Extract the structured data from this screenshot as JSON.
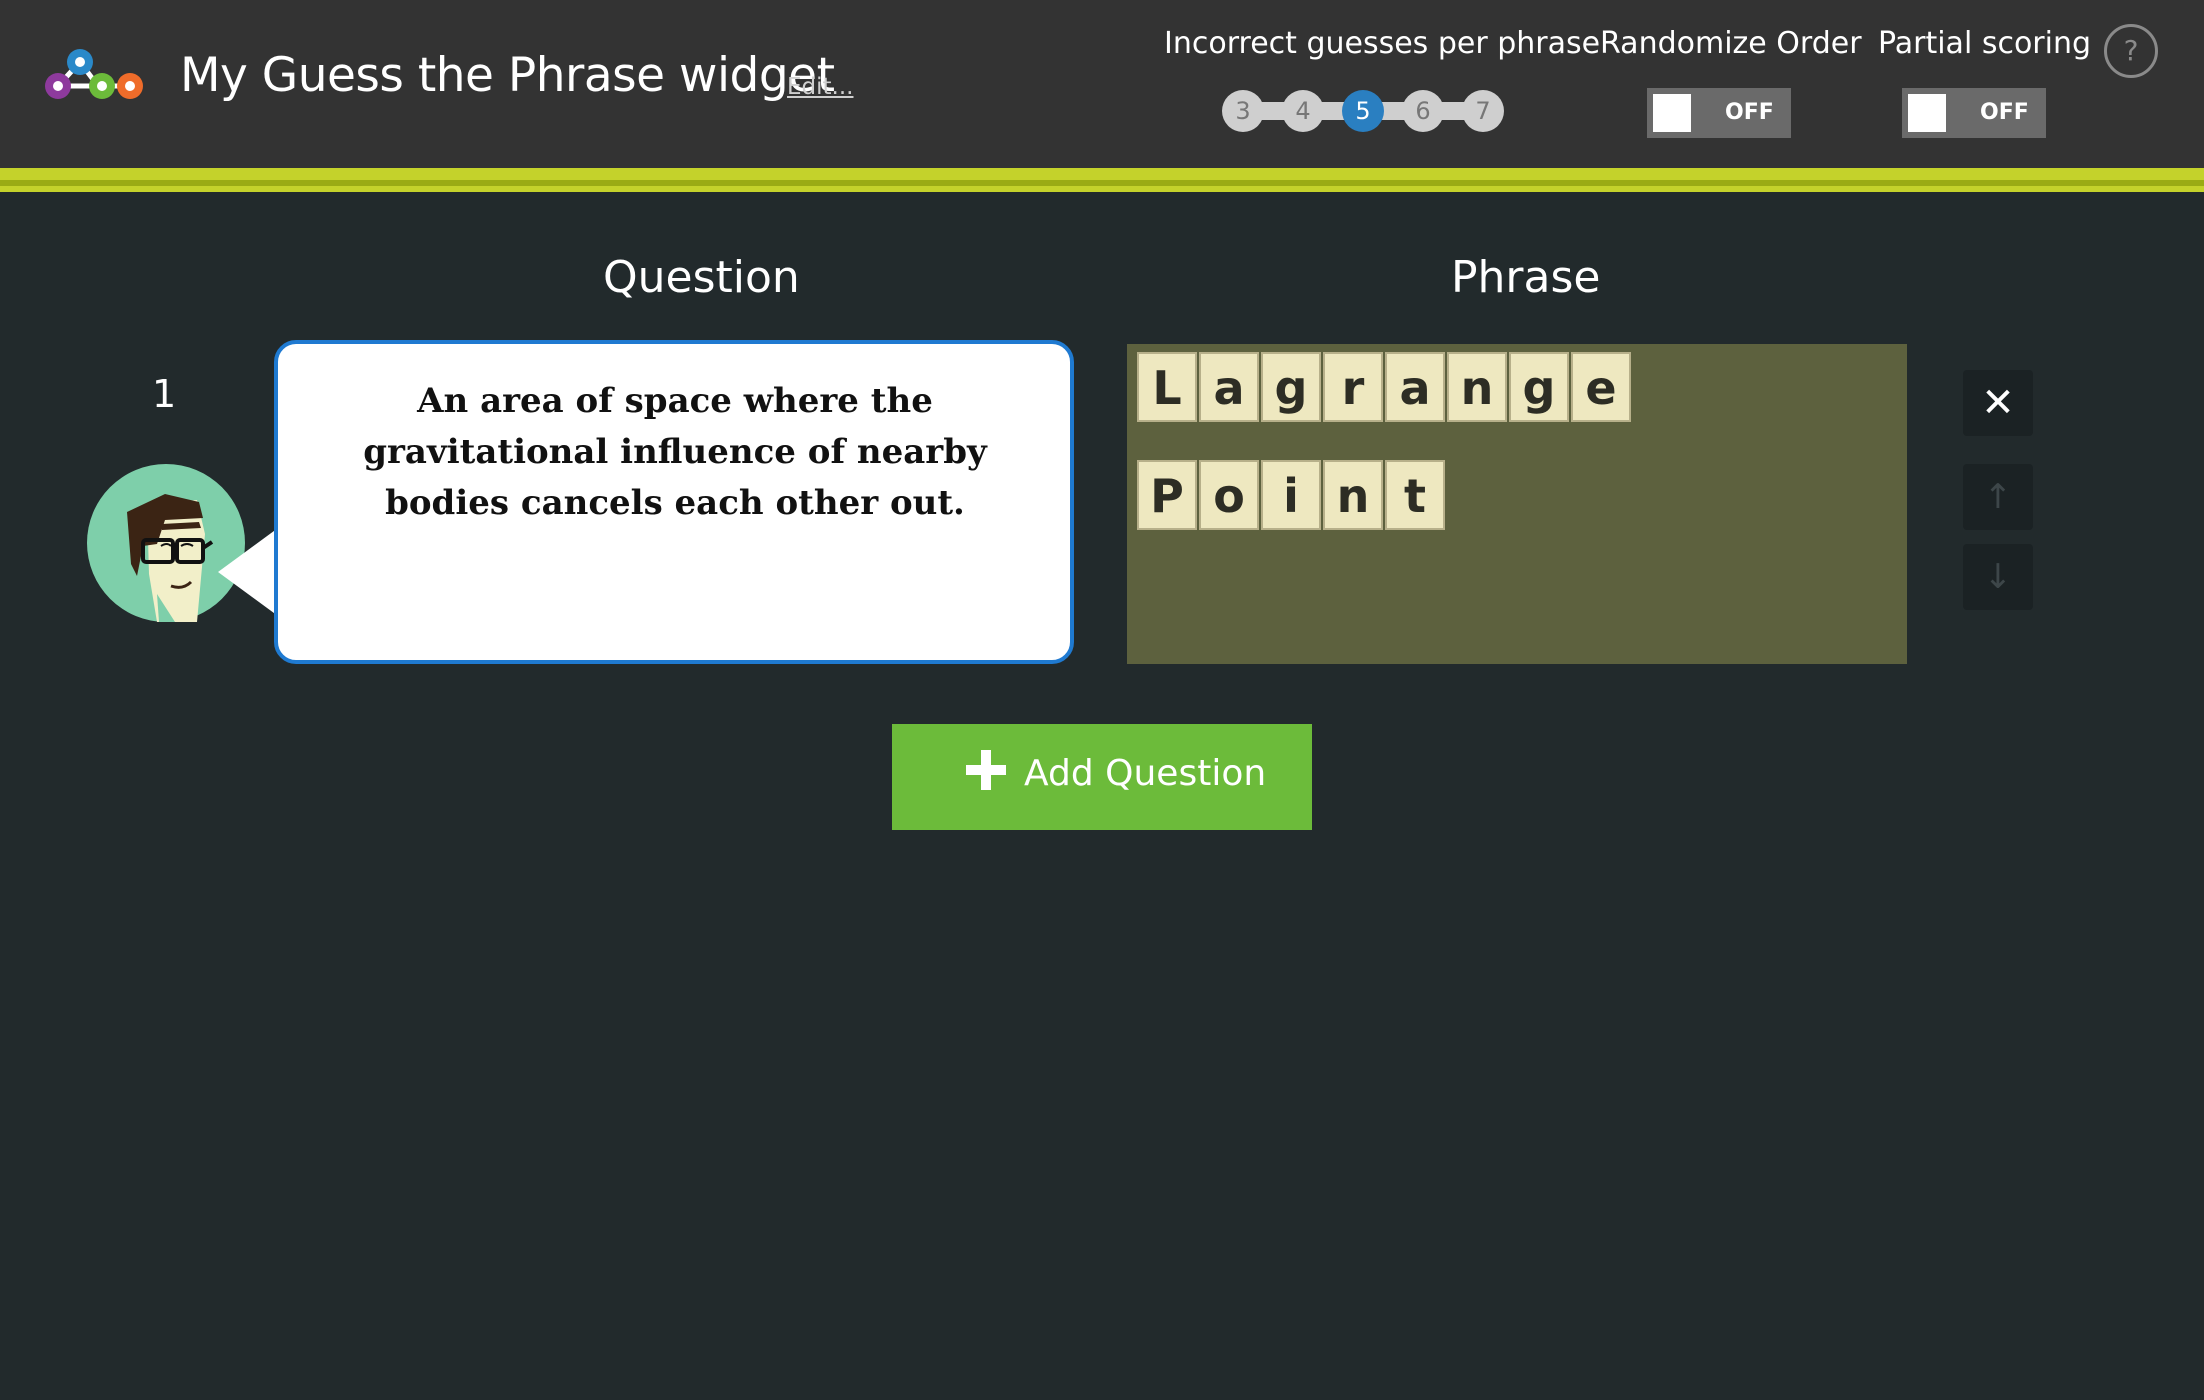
{
  "header": {
    "title": "My Guess the Phrase widget",
    "edit_label": "Edit...",
    "guesses_label": "Incorrect guesses per phrase",
    "guess_options": [
      "3",
      "4",
      "5",
      "6",
      "7"
    ],
    "guess_selected": "5",
    "randomize_label": "Randomize Order",
    "randomize_state": "OFF",
    "partial_label": "Partial scoring",
    "partial_state": "OFF",
    "help_label": "?"
  },
  "columns": {
    "question": "Question",
    "phrase": "Phrase"
  },
  "questions": [
    {
      "number": "1",
      "text": "An area of space where the gravitational influence of nearby bodies cancels each other out.",
      "phrase_words": [
        [
          "L",
          "a",
          "g",
          "r",
          "a",
          "n",
          "g",
          "e"
        ],
        [
          "P",
          "o",
          "i",
          "n",
          "t"
        ]
      ]
    }
  ],
  "side_buttons": {
    "remove": "✕",
    "up": "↑",
    "down": "↓"
  },
  "add_question_label": "Add Question",
  "colors": {
    "header_bg": "#333333",
    "accent_stripe": "#c4d22b",
    "page_bg": "#222a2c",
    "selected_guess": "#2a7fc1",
    "add_button": "#6cbb3a",
    "phrase_board": "#5d613e",
    "tile": "#eee8c0",
    "bubble_border": "#1f7ad1"
  }
}
